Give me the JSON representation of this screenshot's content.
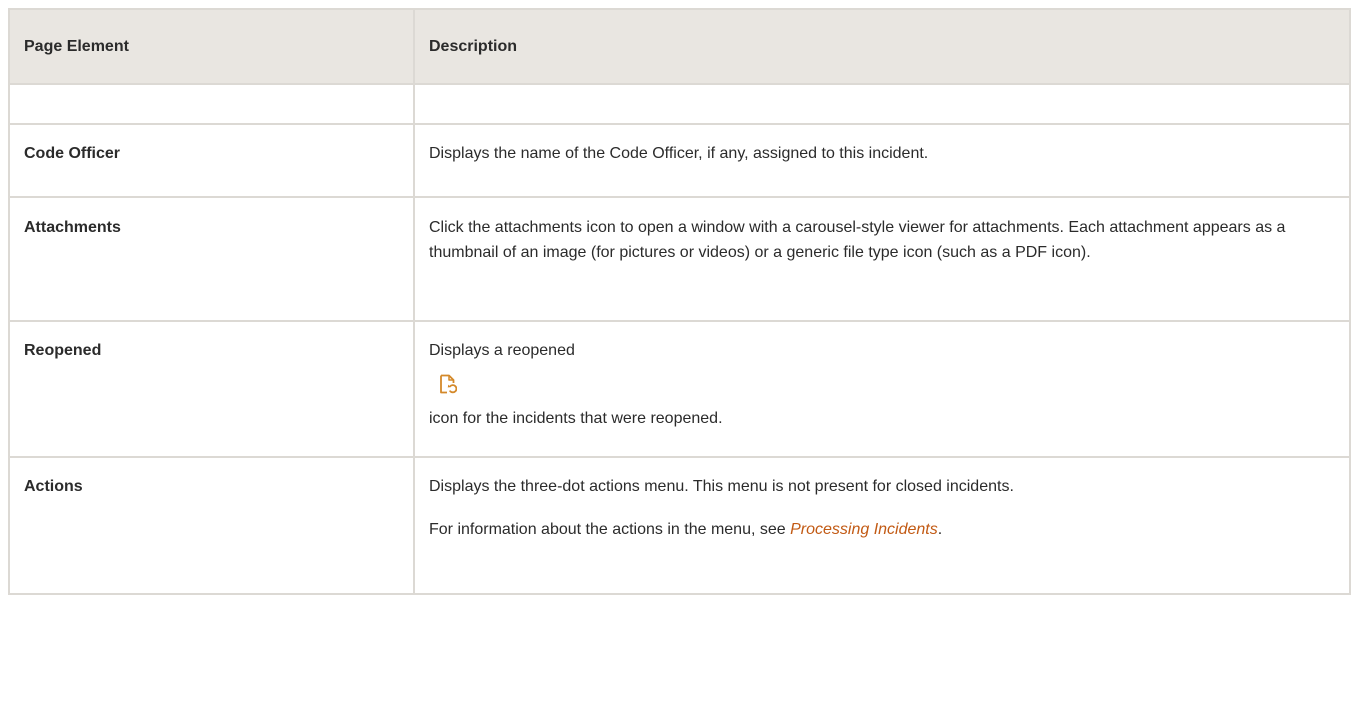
{
  "table": {
    "headers": {
      "element": "Page Element",
      "description": "Description"
    },
    "rows": [
      {
        "element": "",
        "description": ""
      },
      {
        "element": "Code Officer",
        "description": "Displays the name of the Code Officer, if any, assigned to this incident."
      },
      {
        "element": "Attachments",
        "description": "Click the attachments icon to open a window with a carousel-style viewer for attachments. Each attachment appears as a thumbnail of an image (for pictures or videos) or a generic file type icon (such as a PDF icon)."
      },
      {
        "element": "Reopened",
        "description_before_icon": "Displays a reopened",
        "icon": "reopened-file-icon",
        "description_after_icon": "icon for the incidents that were reopened."
      },
      {
        "element": "Actions",
        "description": "Displays the three-dot actions menu. This menu is not present for closed incidents.",
        "note_prefix": "For information about the actions in the menu, see ",
        "note_link": "Processing Incidents",
        "note_suffix": "."
      }
    ]
  },
  "colors": {
    "header_background": "#e9e6e1",
    "border": "#dcd9d4",
    "link": "#c25a14",
    "icon": "#d4892a"
  }
}
